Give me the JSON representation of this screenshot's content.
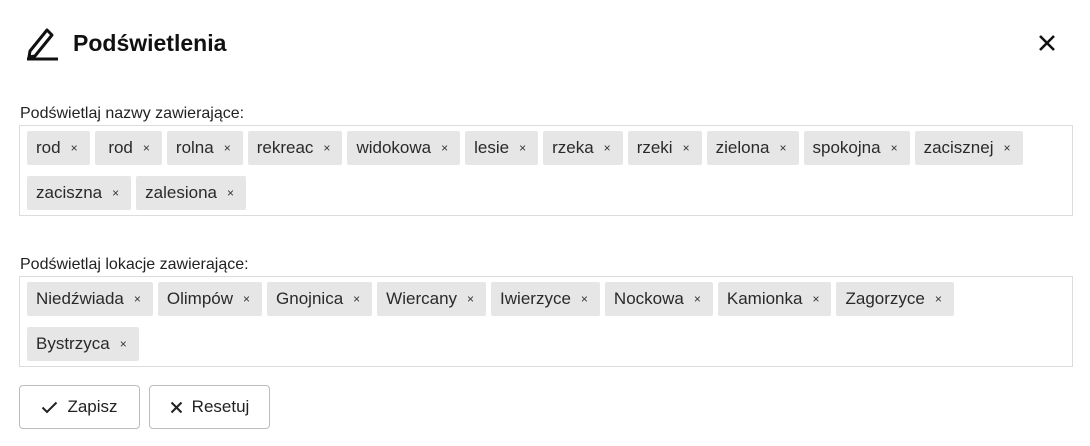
{
  "dialog": {
    "title": "Podświetlenia",
    "title_icon": "pencil-icon",
    "close_icon": "close-icon"
  },
  "names_section": {
    "label": "Podświetlaj nazwy zawierające:",
    "tags": [
      "rod",
      " rod",
      "rolna",
      "rekreac",
      "widokowa",
      "lesie",
      "rzeka",
      "rzeki",
      "zielona",
      "spokojna",
      "zacisznej",
      "zaciszna",
      "zalesiona"
    ]
  },
  "locations_section": {
    "label": "Podświetlaj lokacje zawierające:",
    "tags": [
      "Niedźwiada",
      "Olimpów",
      "Gnojnica",
      "Wiercany",
      "Iwierzyce",
      "Nockowa",
      "Kamionka",
      "Zagorzyce",
      "Bystrzyca"
    ]
  },
  "tag_remove_glyph": "×",
  "buttons": {
    "save": {
      "label": "Zapisz",
      "icon": "check-icon"
    },
    "reset": {
      "label": "Resetuj",
      "icon": "x-icon"
    }
  }
}
